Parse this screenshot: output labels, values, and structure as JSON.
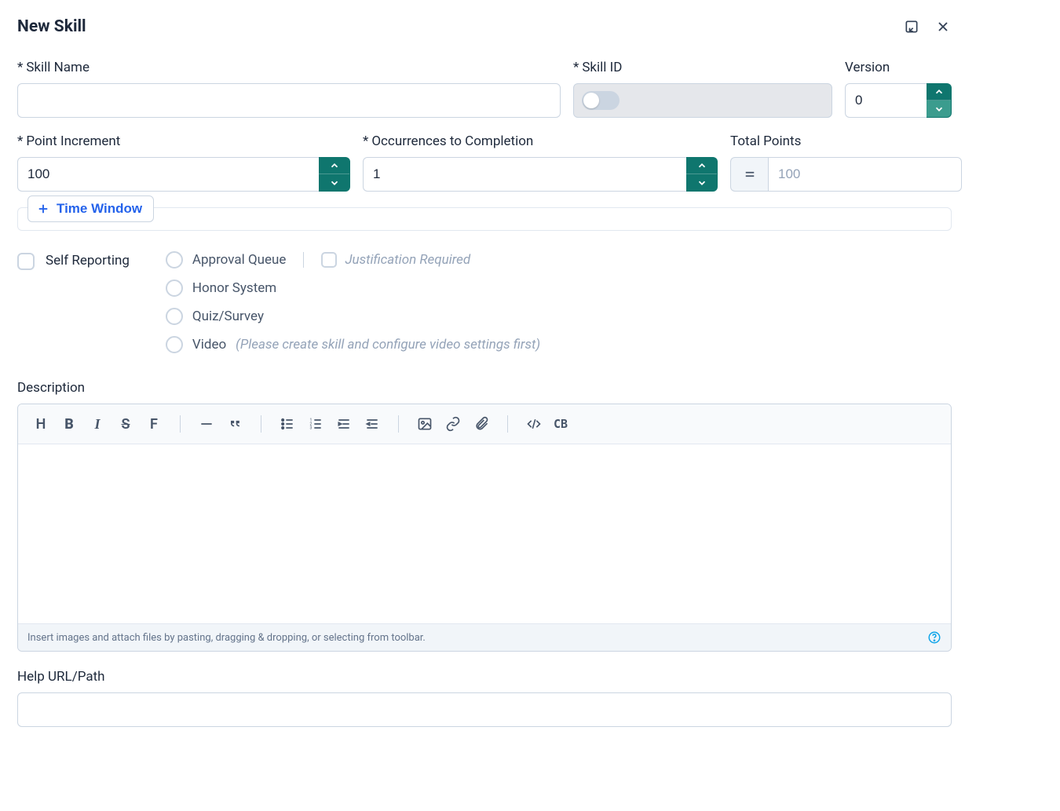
{
  "header": {
    "title": "New Skill"
  },
  "fields": {
    "skillName": {
      "label": "Skill Name",
      "value": ""
    },
    "skillId": {
      "label": "Skill ID",
      "value": "",
      "locked": true
    },
    "version": {
      "label": "Version",
      "value": "0"
    },
    "pointIncrement": {
      "label": "Point Increment",
      "value": "100"
    },
    "occurrences": {
      "label": "Occurrences to Completion",
      "value": "1"
    },
    "totalPoints": {
      "label": "Total Points",
      "value": "100"
    }
  },
  "timeWindow": {
    "buttonLabel": "Time Window"
  },
  "selfReporting": {
    "checkboxLabel": "Self Reporting",
    "options": [
      {
        "label": "Approval Queue"
      },
      {
        "label": "Honor System"
      },
      {
        "label": "Quiz/Survey"
      },
      {
        "label": "Video",
        "hint": "(Please create skill and configure video settings first)"
      }
    ],
    "justification": {
      "label": "Justification Required"
    }
  },
  "description": {
    "label": "Description",
    "footerHint": "Insert images and attach files by pasting, dragging & dropping, or selecting from toolbar."
  },
  "toolbar": {
    "heading": "H",
    "bold": "B",
    "italic": "I",
    "strike": "S",
    "font": "F",
    "quote": "“”",
    "codeBlock": "CB"
  },
  "helpUrl": {
    "label": "Help URL/Path",
    "value": ""
  }
}
